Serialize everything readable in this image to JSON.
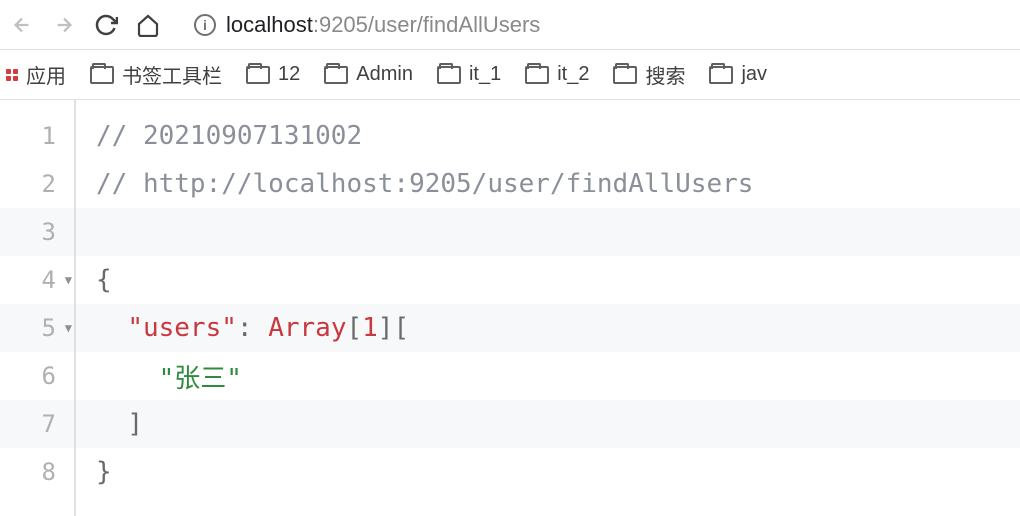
{
  "toolbar": {
    "url_host": "localhost",
    "url_port_path": ":9205/user/findAllUsers"
  },
  "bookmarks": {
    "apps_label": "应用",
    "items": [
      "书签工具栏",
      "12",
      "Admin",
      "it_1",
      "it_2",
      "搜索",
      "jav"
    ]
  },
  "code": {
    "lines": [
      "1",
      "2",
      "3",
      "4",
      "5",
      "6",
      "7",
      "8"
    ],
    "comment1": "// 20210907131002",
    "comment2": "// http://localhost:9205/user/findAllUsers",
    "brace_open": "{",
    "key_users": "\"users\"",
    "colon": ": ",
    "array_label": "Array",
    "bracket_open1": "[",
    "array_count": "1",
    "bracket_close1": "]",
    "bracket_open2": "[",
    "user_value": "\"张三\"",
    "bracket_close2": "]",
    "brace_close": "}"
  }
}
